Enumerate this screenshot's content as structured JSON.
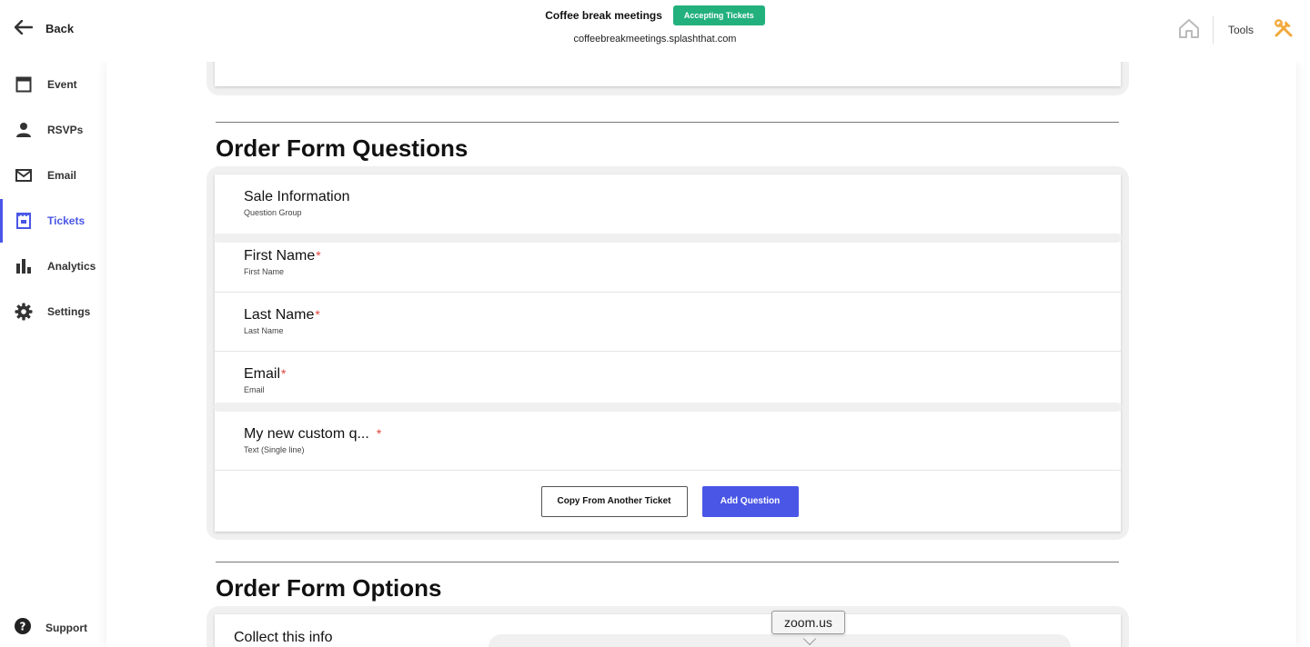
{
  "header": {
    "back_label": "Back",
    "event_name": "Coffee break meetings",
    "status": "Accepting Tickets",
    "event_url": "coffeebreakmeetings.splashthat.com",
    "tools_label": "Tools"
  },
  "sidebar": {
    "items": [
      {
        "label": "Event",
        "icon": "calendar-icon"
      },
      {
        "label": "RSVPs",
        "icon": "person-icon"
      },
      {
        "label": "Email",
        "icon": "envelope-icon"
      },
      {
        "label": "Tickets",
        "icon": "ticket-icon",
        "active": true
      },
      {
        "label": "Analytics",
        "icon": "bar-chart-icon"
      },
      {
        "label": "Settings",
        "icon": "gear-icon"
      }
    ],
    "support_label": "Support"
  },
  "order_form_questions": {
    "heading": "Order Form Questions",
    "group": {
      "title": "Sale Information",
      "subtitle": "Question Group"
    },
    "questions": [
      {
        "title": "First Name",
        "subtitle": "First Name",
        "required_mark": "*"
      },
      {
        "title": "Last Name",
        "subtitle": "Last Name",
        "required_mark": "*"
      },
      {
        "title": "Email",
        "subtitle": "Email",
        "required_mark": "*"
      },
      {
        "title": "My new custom q...",
        "subtitle": "Text (Single line)",
        "required_mark": "*"
      }
    ],
    "copy_button": "Copy From Another Ticket",
    "add_button": "Add Question"
  },
  "order_form_options": {
    "heading": "Order Form Options",
    "collect_label": "Collect this info"
  },
  "tooltip": "zoom.us",
  "colors": {
    "accent": "#4a56e6",
    "status_green": "#22b07d",
    "required_red": "#e0423b"
  }
}
